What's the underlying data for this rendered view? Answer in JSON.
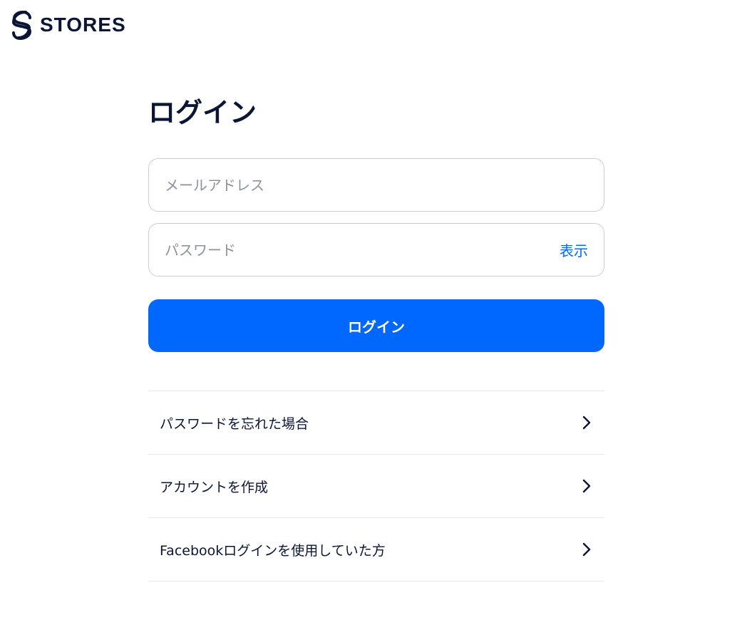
{
  "brand": {
    "name": "STORES",
    "logo_icon": "stores-logo-icon",
    "color": "#0a1633"
  },
  "page": {
    "title": "ログイン"
  },
  "form": {
    "email_placeholder": "メールアドレス",
    "email_value": "",
    "password_placeholder": "パスワード",
    "password_value": "",
    "show_password_label": "表示",
    "submit_label": "ログイン"
  },
  "links": [
    {
      "label": "パスワードを忘れた場合",
      "icon": "chevron-right-icon"
    },
    {
      "label": "アカウントを作成",
      "icon": "chevron-right-icon"
    },
    {
      "label": "Facebookログインを使用していた方",
      "icon": "chevron-right-icon"
    }
  ],
  "colors": {
    "accent": "#0068ff",
    "text": "#0a1633",
    "placeholder": "#8a9399",
    "border": "#c9cdd2",
    "divider": "#e6e8ea"
  }
}
